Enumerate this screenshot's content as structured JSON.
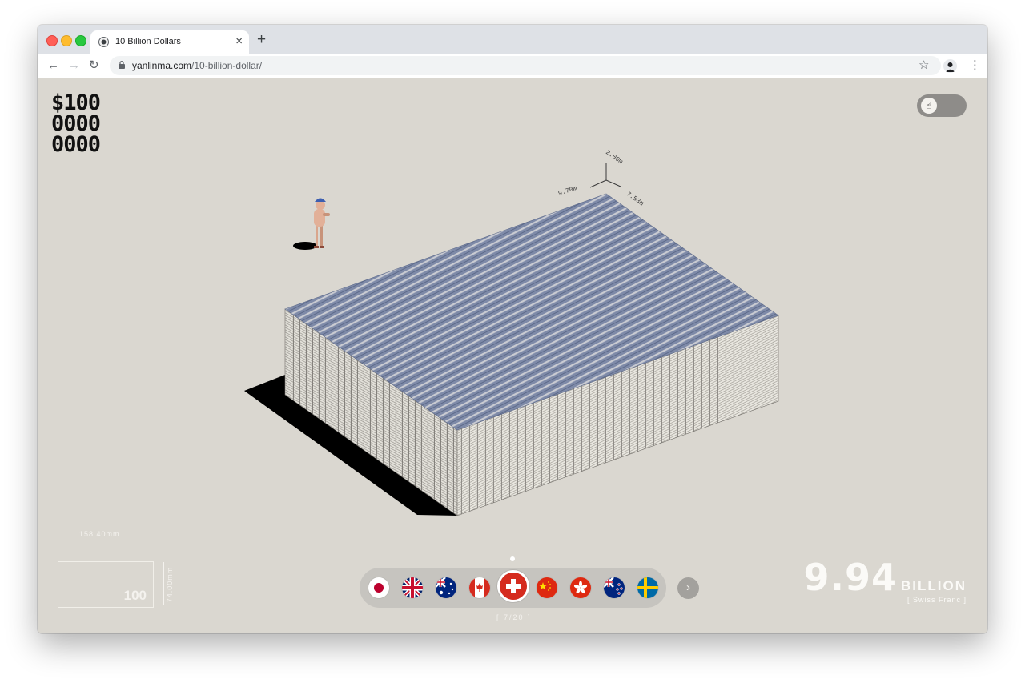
{
  "browser": {
    "tab_title": "10 Billion Dollars",
    "tab_close_icon": "close-icon",
    "new_tab_icon": "plus-icon",
    "url_domain": "yanlinma.com",
    "url_path": "/10-billion-dollar/",
    "back_icon": "back-arrow-icon",
    "forward_icon": "forward-arrow-icon",
    "reload_icon": "reload-icon",
    "bookmark_icon": "star-icon",
    "menu_icon": "kebab-menu-icon"
  },
  "page": {
    "amount_lines": [
      "$100",
      "0000",
      "0000"
    ],
    "toggle_icon": "pointing-hand-icon",
    "scene": {
      "dim_height": "2.06m",
      "dim_width": "9.70m",
      "dim_depth": "7.53m"
    },
    "note": {
      "width_label": "158.40mm",
      "height_label": "74.00mm",
      "denomination": "100"
    },
    "flags": [
      {
        "name": "japan",
        "active": false
      },
      {
        "name": "united-kingdom",
        "active": false
      },
      {
        "name": "australia",
        "active": false
      },
      {
        "name": "canada",
        "active": false
      },
      {
        "name": "switzerland",
        "active": true
      },
      {
        "name": "china",
        "active": false
      },
      {
        "name": "hong-kong",
        "active": false
      },
      {
        "name": "new-zealand",
        "active": false
      },
      {
        "name": "sweden",
        "active": false
      }
    ],
    "next_icon": "chevron-right-icon",
    "counter": "[ 7/20 ]",
    "total_value": "9.94",
    "total_unit": "BILLION",
    "currency": "[ Swiss Franc ]",
    "colors": {
      "background": "#dad7d0",
      "active_flag": "#d52b1e",
      "note_top": "#6b7b9c"
    }
  }
}
